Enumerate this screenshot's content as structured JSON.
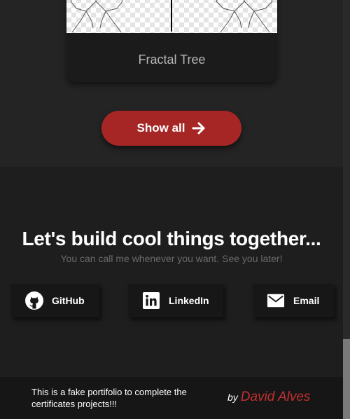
{
  "projects": {
    "card_title": "Fractal Tree",
    "show_all_label": "Show all"
  },
  "contact": {
    "heading": "Let's build cool things together...",
    "subtitle": "You can call me whenever you want. See you later!",
    "buttons": [
      {
        "label": "GitHub",
        "icon": "github-icon"
      },
      {
        "label": "LinkedIn",
        "icon": "linkedin-icon"
      },
      {
        "label": "Email",
        "icon": "mail-icon"
      }
    ]
  },
  "footer": {
    "note": "This is a fake portifolio to complete the certificates projects!!!",
    "by": "by",
    "author": "David Alves"
  },
  "colors": {
    "accent": "#a62626",
    "author": "#c23030",
    "background": "#1e1e1e"
  }
}
